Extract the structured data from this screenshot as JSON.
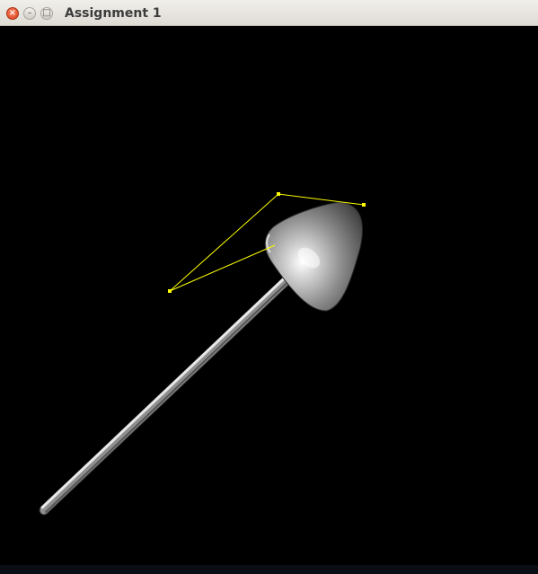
{
  "window": {
    "title": "Assignment 1",
    "close_glyph": "×",
    "minimize_glyph": "–",
    "maximize_glyph": "□"
  },
  "scene": {
    "background_color": "#000000",
    "control_polygon_color": "#ffff00",
    "object_color": "#8a8a8a",
    "object": "pointing-arrow-3d",
    "control_points_visible": 4
  }
}
